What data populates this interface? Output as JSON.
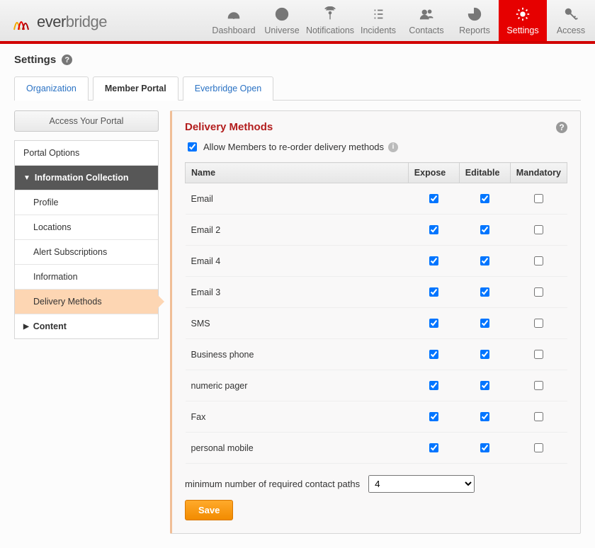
{
  "brand": {
    "logo_prefix": "ever",
    "logo_suffix": "bridge"
  },
  "nav": {
    "items": [
      {
        "label": "Dashboard"
      },
      {
        "label": "Universe"
      },
      {
        "label": "Notifications"
      },
      {
        "label": "Incidents"
      },
      {
        "label": "Contacts"
      },
      {
        "label": "Reports"
      },
      {
        "label": "Settings"
      },
      {
        "label": "Access"
      }
    ],
    "active_index": 6
  },
  "page_title": "Settings",
  "tabs": {
    "items": [
      {
        "label": "Organization"
      },
      {
        "label": "Member Portal"
      },
      {
        "label": "Everbridge Open"
      }
    ],
    "active_index": 1
  },
  "left": {
    "portal_button": "Access Your Portal",
    "nav": [
      {
        "label": "Portal Options",
        "type": "section-plain"
      },
      {
        "label": "Information Collection",
        "type": "section-expanded"
      },
      {
        "label": "Profile",
        "type": "sub"
      },
      {
        "label": "Locations",
        "type": "sub"
      },
      {
        "label": "Alert Subscriptions",
        "type": "sub"
      },
      {
        "label": "Information",
        "type": "sub"
      },
      {
        "label": "Delivery Methods",
        "type": "sub-active"
      },
      {
        "label": "Content",
        "type": "section-collapsed"
      }
    ]
  },
  "panel": {
    "title": "Delivery Methods",
    "allow_reorder_label": "Allow Members to re-order delivery methods",
    "allow_reorder_checked": true,
    "columns": {
      "name": "Name",
      "expose": "Expose",
      "editable": "Editable",
      "mandatory": "Mandatory"
    },
    "rows": [
      {
        "name": "Email",
        "expose": true,
        "editable": true,
        "mandatory": false
      },
      {
        "name": "Email 2",
        "expose": true,
        "editable": true,
        "mandatory": false
      },
      {
        "name": "Email 4",
        "expose": true,
        "editable": true,
        "mandatory": false
      },
      {
        "name": "Email 3",
        "expose": true,
        "editable": true,
        "mandatory": false
      },
      {
        "name": "SMS",
        "expose": true,
        "editable": true,
        "mandatory": false
      },
      {
        "name": "Business phone",
        "expose": true,
        "editable": true,
        "mandatory": false
      },
      {
        "name": "numeric pager",
        "expose": true,
        "editable": true,
        "mandatory": false
      },
      {
        "name": "Fax",
        "expose": true,
        "editable": true,
        "mandatory": false
      },
      {
        "name": "personal mobile",
        "expose": true,
        "editable": true,
        "mandatory": false
      }
    ],
    "min_label": "minimum number of required contact paths",
    "min_value": "4",
    "save_label": "Save"
  }
}
